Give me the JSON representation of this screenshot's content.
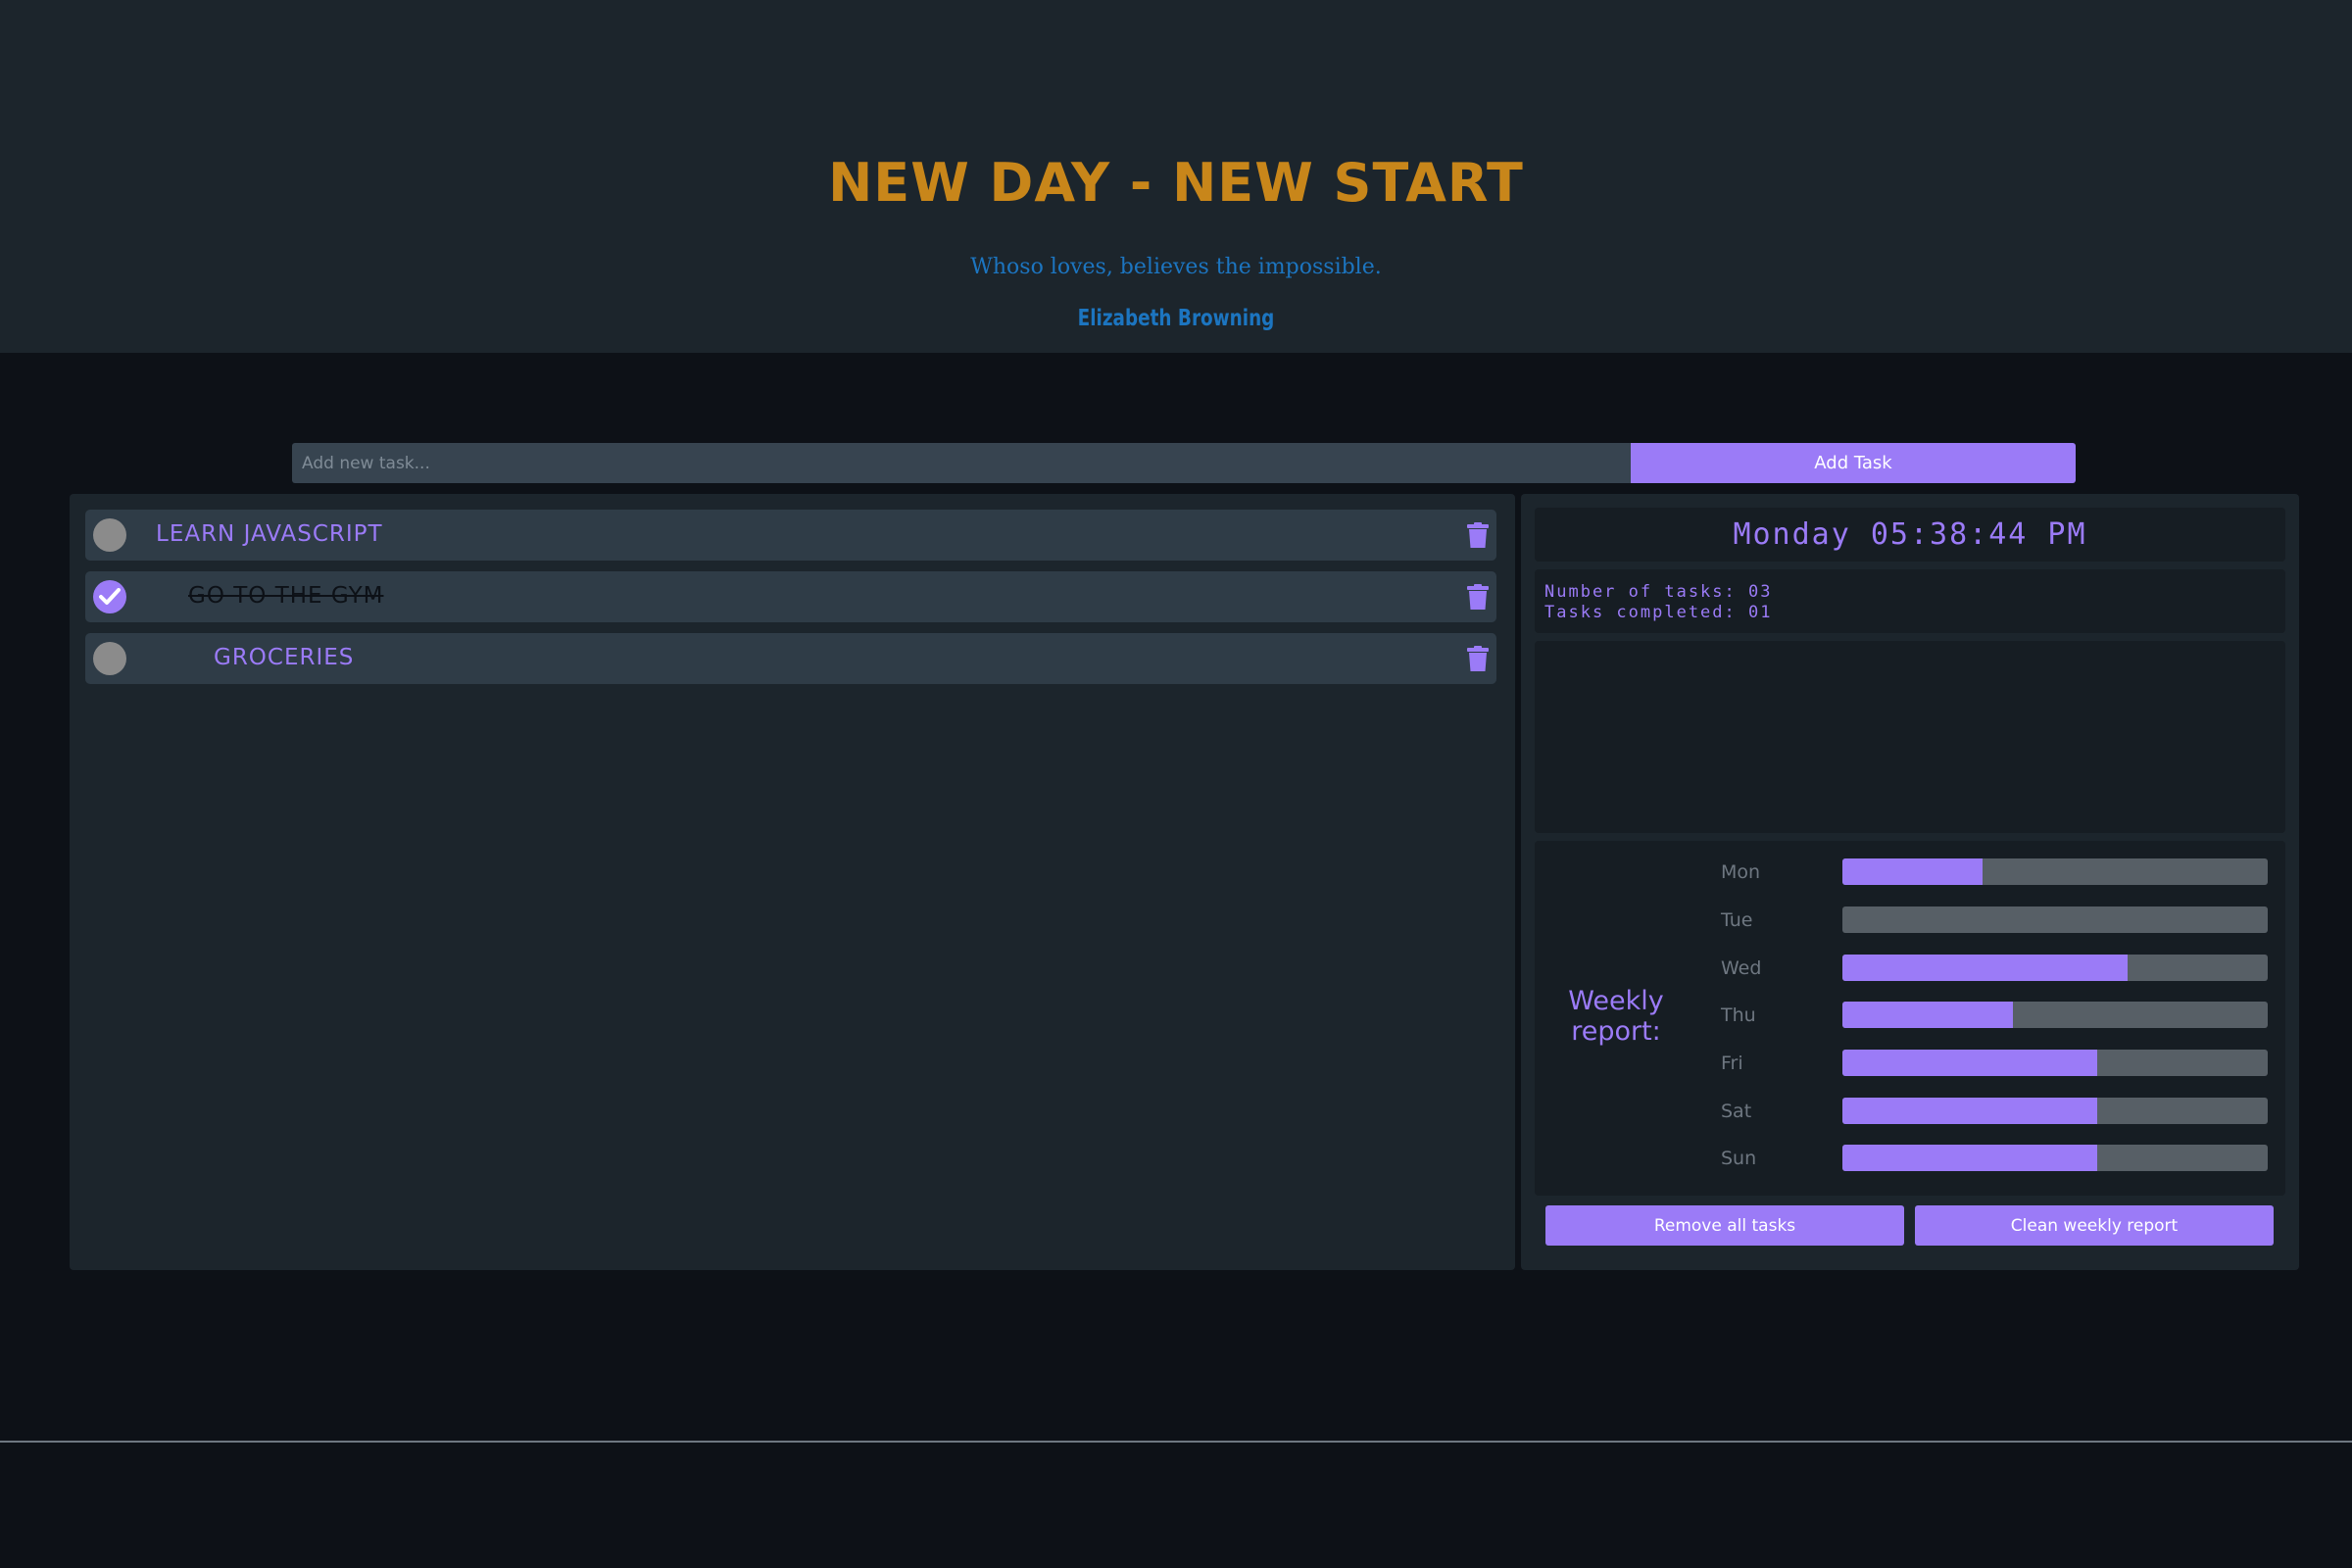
{
  "header": {
    "title": "NEW DAY - NEW START",
    "quote": "Whoso loves, believes the impossible.",
    "author": "Elizabeth Browning"
  },
  "add_task": {
    "placeholder": "Add new task...",
    "button_label": "Add Task"
  },
  "tasks": [
    {
      "label": "LEARN JAVASCRIPT",
      "completed": false
    },
    {
      "label": "GO TO THE GYM",
      "completed": true
    },
    {
      "label": "GROCERIES",
      "completed": false
    }
  ],
  "clock": {
    "text": "Monday 05:38:44 PM"
  },
  "stats": {
    "number_of_tasks": "Number of tasks: 03",
    "tasks_completed": "Tasks completed: 01"
  },
  "weekly_report": {
    "title": "Weekly report:",
    "days": [
      {
        "label": "Mon",
        "fraction": 0.33
      },
      {
        "label": "Tue",
        "fraction": 0.0
      },
      {
        "label": "Wed",
        "fraction": 0.67
      },
      {
        "label": "Thu",
        "fraction": 0.4
      },
      {
        "label": "Fri",
        "fraction": 0.6
      },
      {
        "label": "Sat",
        "fraction": 0.6
      },
      {
        "label": "Sun",
        "fraction": 0.6
      }
    ]
  },
  "actions": {
    "remove_all_label": "Remove all tasks",
    "clean_report_label": "Clean weekly report"
  },
  "colors": {
    "accent": "#9b7bf7",
    "title": "#c8861a",
    "quote": "#1c75c0",
    "header_bg": "#1c252c",
    "page_bg": "#0d1117"
  },
  "icons": {
    "check": "check-icon",
    "trash": "trash-icon"
  }
}
